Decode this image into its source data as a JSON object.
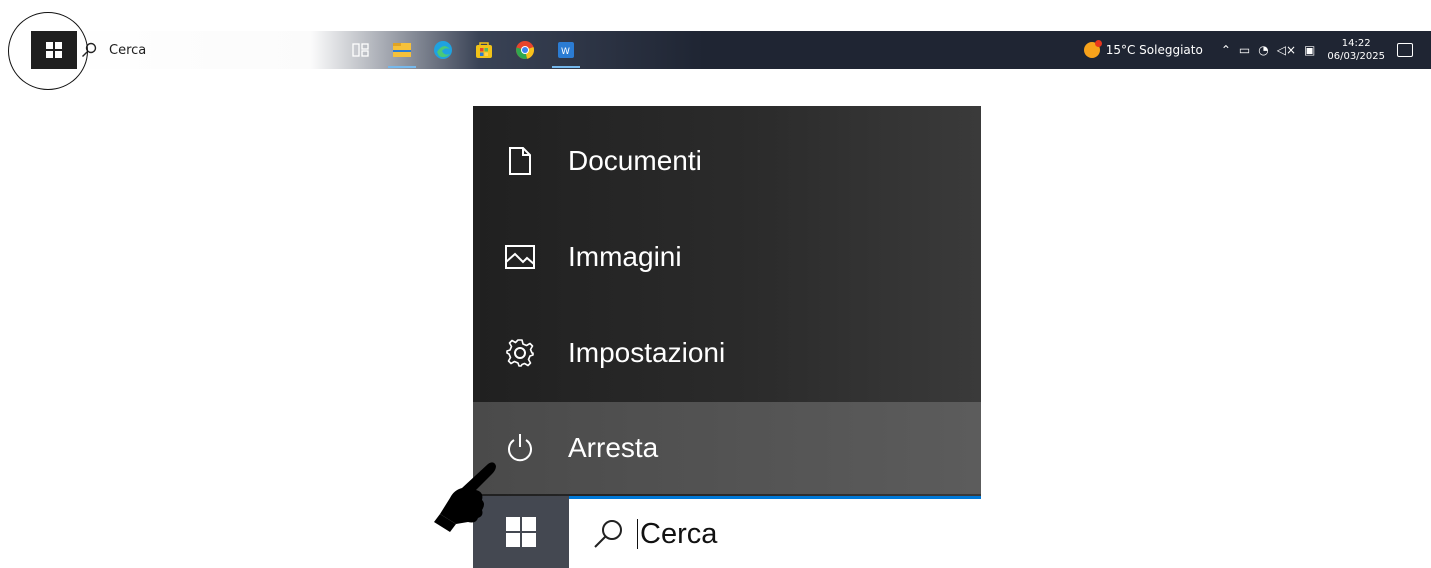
{
  "taskbar": {
    "search_label": "Cerca",
    "apps": [
      {
        "icon": "task-view-icon",
        "color": "#ffffff"
      },
      {
        "icon": "file-explorer-icon",
        "color": "#f6c13a"
      },
      {
        "icon": "edge-icon",
        "color": "#1fa2e0"
      },
      {
        "icon": "store-icon",
        "color": "#f2c318"
      },
      {
        "icon": "chrome-icon",
        "color": "#e8452c"
      },
      {
        "icon": "word-icon",
        "color": "#2b7cd3"
      }
    ],
    "weather": "15°C Soleggiato",
    "time": "14:22",
    "date": "06/03/2025"
  },
  "start_menu": {
    "items": [
      {
        "label": "Documenti",
        "icon": "document-icon"
      },
      {
        "label": "Immagini",
        "icon": "pictures-icon"
      },
      {
        "label": "Impostazioni",
        "icon": "gear-icon"
      },
      {
        "label": "Arresta",
        "icon": "power-icon"
      }
    ],
    "search_label": "Cerca"
  },
  "colors": {
    "taskbar_dark": "#1f2533",
    "menu_bg": "#2b2b2b",
    "highlight": "#5c5c5c",
    "accent": "#0078d7"
  }
}
